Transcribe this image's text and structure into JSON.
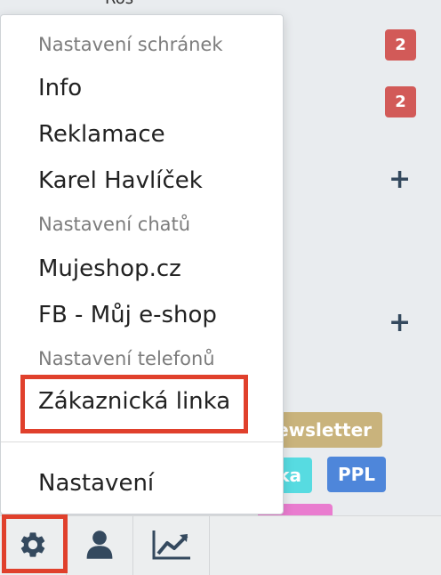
{
  "background": {
    "top_cut_text": "Ros",
    "badges": [
      "2",
      "2"
    ],
    "tags": {
      "newsletter": "ewsletter",
      "cyan": "ka",
      "ppl": "PPL"
    }
  },
  "menu": {
    "header_mailboxes": "Nastavení schránek",
    "mailboxes": [
      "Info",
      "Reklamace",
      "Karel Havlíček"
    ],
    "header_chats": "Nastavení chatů",
    "chats": [
      "Mujeshop.cz",
      "FB - Můj e-shop"
    ],
    "header_phones": "Nastavení telefonů",
    "phones": [
      "Zákaznická linka"
    ],
    "settings": "Nastavení"
  },
  "colors": {
    "badge_red": "#d25a58",
    "highlight": "#e0402c",
    "icon": "#34495e"
  },
  "toolbar": {
    "icons": [
      "gear-icon",
      "user-icon",
      "chart-icon"
    ]
  }
}
